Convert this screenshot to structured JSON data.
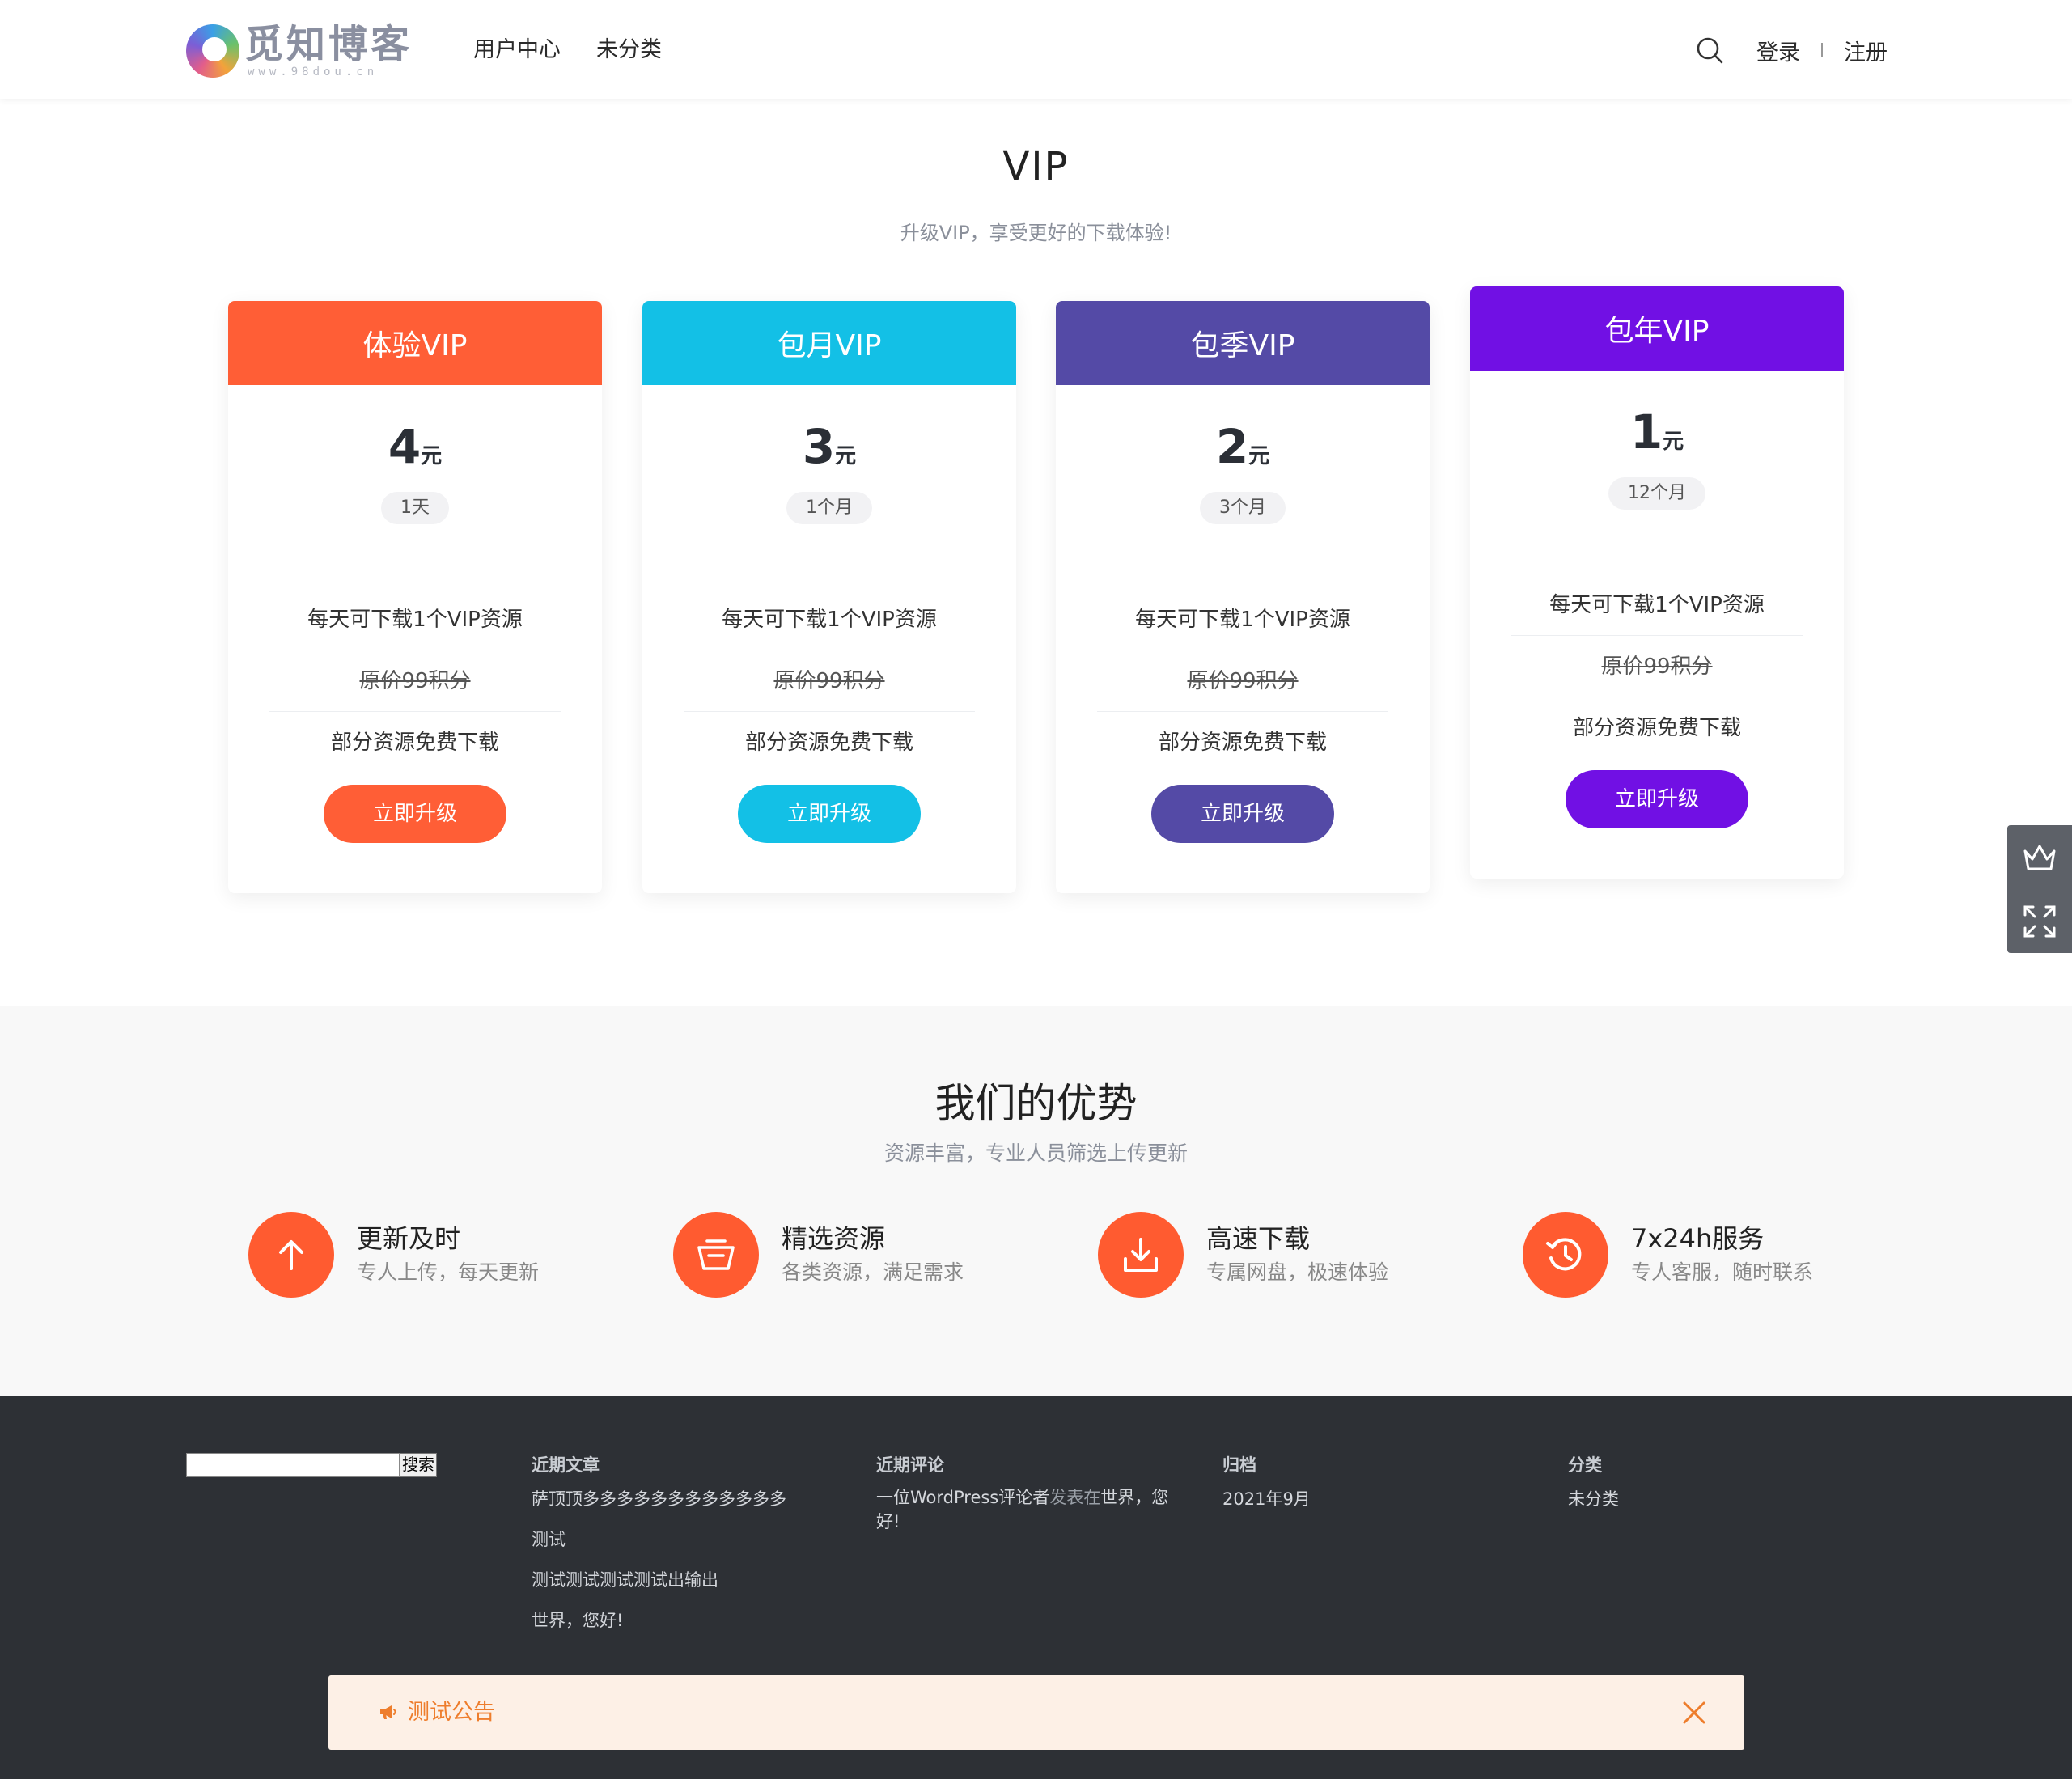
{
  "header": {
    "logo_title": "觅知博客",
    "logo_sub": "www.98dou.cn",
    "nav": [
      "用户中心",
      "未分类"
    ],
    "login": "登录",
    "register": "注册",
    "icons": {
      "search": "search-icon"
    }
  },
  "vip": {
    "title": "VIP",
    "subtitle": "升级VIP，享受更好的下载体验!",
    "plans": [
      {
        "name": "体验VIP",
        "price": "4",
        "unit": "元",
        "period": "1天",
        "features": [
          "每天可下载1个VIP资源",
          "原价99积分",
          "部分资源免费下载"
        ],
        "button": "立即升级",
        "color": "#ff5e36"
      },
      {
        "name": "包月VIP",
        "price": "3",
        "unit": "元",
        "period": "1个月",
        "features": [
          "每天可下载1个VIP资源",
          "原价99积分",
          "部分资源免费下载"
        ],
        "button": "立即升级",
        "color": "#13c0e6"
      },
      {
        "name": "包季VIP",
        "price": "2",
        "unit": "元",
        "period": "3个月",
        "features": [
          "每天可下载1个VIP资源",
          "原价99积分",
          "部分资源免费下载"
        ],
        "button": "立即升级",
        "color": "#544aa6"
      },
      {
        "name": "包年VIP",
        "price": "1",
        "unit": "元",
        "period": "12个月",
        "features": [
          "每天可下载1个VIP资源",
          "原价99积分",
          "部分资源免费下载"
        ],
        "button": "立即升级",
        "color": "#7110e4"
      }
    ]
  },
  "side_bar": {
    "icons": [
      "crown-icon",
      "fullscreen-icon"
    ]
  },
  "advantages": {
    "title": "我们的优势",
    "subtitle": "资源丰富，专业人员筛选上传更新",
    "items": [
      {
        "name": "更新及时",
        "desc": "专人上传，每天更新",
        "icon": "arrow-up-icon"
      },
      {
        "name": "精选资源",
        "desc": "各类资源，满足需求",
        "icon": "basket-icon"
      },
      {
        "name": "高速下载",
        "desc": "专属网盘，极速体验",
        "icon": "download-icon"
      },
      {
        "name": "7x24h服务",
        "desc": "专人客服，随时联系",
        "icon": "history-icon"
      }
    ],
    "accent": "#ff5b30"
  },
  "footer": {
    "search_button": "搜索",
    "recent_posts_title": "近期文章",
    "recent_posts": [
      "萨顶顶多多多多多多多多多多多多",
      "测试",
      "测试测试测试测试出输出",
      "世界，您好!"
    ],
    "recent_comments_title": "近期评论",
    "comment_author": "一位WordPress评论者",
    "comment_on": "发表在",
    "comment_post": "世界，您好!",
    "archive_title": "归档",
    "archive_items": [
      "2021年9月"
    ],
    "category_title": "分类",
    "category_items": [
      "未分类"
    ]
  },
  "notice": {
    "text": "测试公告",
    "icon": "megaphone-icon",
    "close_icon": "close-icon"
  }
}
